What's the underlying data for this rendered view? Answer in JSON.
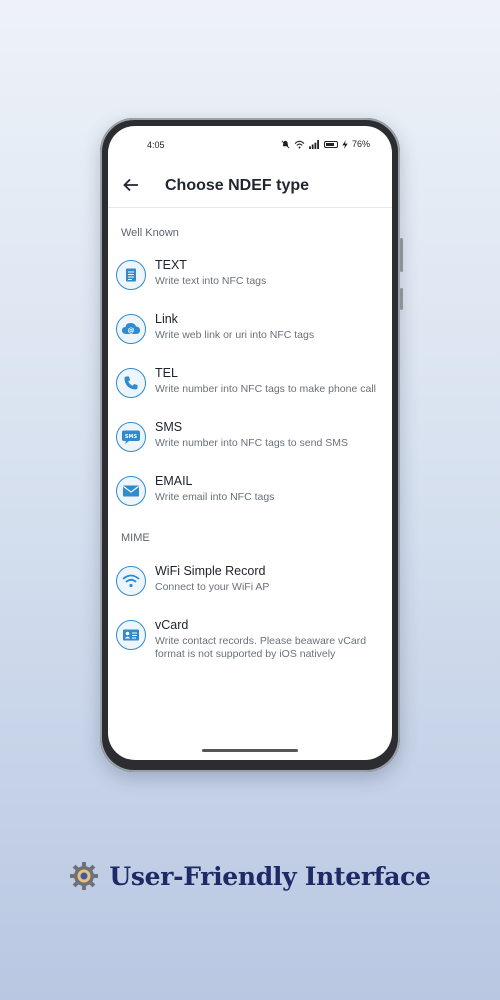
{
  "status_bar": {
    "time": "4:05",
    "battery": "76%"
  },
  "app_bar": {
    "title": "Choose NDEF type"
  },
  "sections": [
    {
      "title": "Well Known",
      "items": [
        {
          "label": "TEXT",
          "desc": "Write text into NFC tags",
          "icon": "text-document-icon"
        },
        {
          "label": "Link",
          "desc": "Write web link or uri into NFC tags",
          "icon": "link-at-icon"
        },
        {
          "label": "TEL",
          "desc": "Write number into NFC tags to make phone call",
          "icon": "phone-icon"
        },
        {
          "label": "SMS",
          "desc": "Write number into NFC tags to send SMS",
          "icon": "sms-icon"
        },
        {
          "label": "EMAIL",
          "desc": "Write email into NFC tags",
          "icon": "email-icon"
        }
      ]
    },
    {
      "title": "MIME",
      "items": [
        {
          "label": "WiFi Simple Record",
          "desc": "Connect to your WiFi AP",
          "icon": "wifi-icon"
        },
        {
          "label": "vCard",
          "desc": "Write contact records. Please beaware vCard format is not supported by iOS natively",
          "icon": "vcard-icon"
        }
      ]
    }
  ],
  "caption": {
    "text": "User-Friendly Interface",
    "icon": "gear-icon"
  },
  "colors": {
    "accent": "#2e8bd0",
    "caption": "#1d2a66"
  }
}
